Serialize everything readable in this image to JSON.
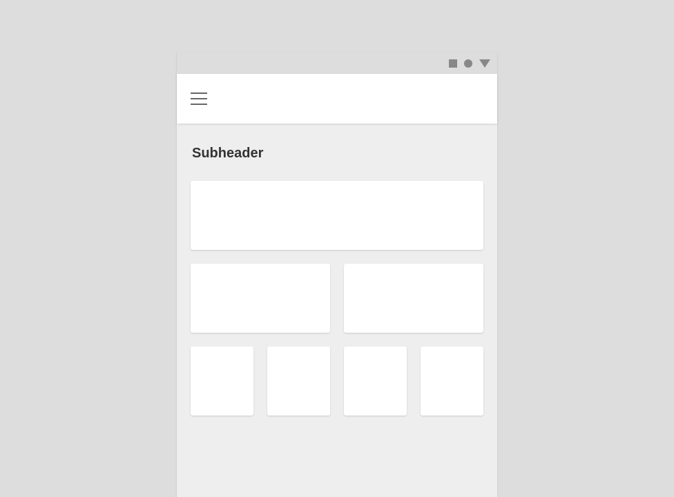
{
  "subheader": "Subheader",
  "statusIcons": [
    "square",
    "circle",
    "triangle"
  ],
  "cards": {
    "row1": [
      {}
    ],
    "row2": [
      {},
      {}
    ],
    "row3": [
      {},
      {},
      {},
      {}
    ]
  }
}
